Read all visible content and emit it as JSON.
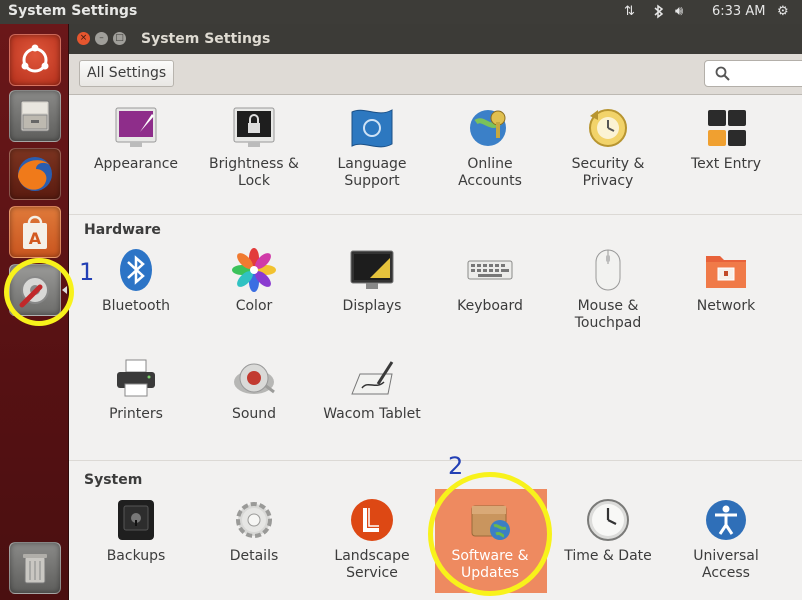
{
  "top_panel": {
    "title": "System Settings",
    "time": "6:33 AM",
    "icons": [
      "network-transfer-icon",
      "bluetooth-icon",
      "volume-icon",
      "power-gear-icon"
    ]
  },
  "launcher": {
    "items": [
      "ubuntu-dash-icon",
      "files-icon",
      "firefox-icon",
      "software-center-icon",
      "system-settings-icon",
      "trash-icon"
    ]
  },
  "window": {
    "title": "System Settings",
    "all_settings_label": "All Settings",
    "search_placeholder": ""
  },
  "personal": {
    "items": [
      {
        "label": "Appearance",
        "icon": "appearance-icon"
      },
      {
        "label": "Brightness &\nLock",
        "icon": "brightness-lock-icon"
      },
      {
        "label": "Language\nSupport",
        "icon": "language-support-icon"
      },
      {
        "label": "Online\nAccounts",
        "icon": "online-accounts-icon"
      },
      {
        "label": "Security &\nPrivacy",
        "icon": "security-privacy-icon"
      },
      {
        "label": "Text Entry",
        "icon": "text-entry-icon"
      }
    ]
  },
  "hardware": {
    "heading": "Hardware",
    "items": [
      {
        "label": "Bluetooth",
        "icon": "bluetooth-icon"
      },
      {
        "label": "Color",
        "icon": "color-icon"
      },
      {
        "label": "Displays",
        "icon": "displays-icon"
      },
      {
        "label": "Keyboard",
        "icon": "keyboard-icon"
      },
      {
        "label": "Mouse &\nTouchpad",
        "icon": "mouse-icon"
      },
      {
        "label": "Network",
        "icon": "network-icon"
      },
      {
        "label": "Printers",
        "icon": "printer-icon"
      },
      {
        "label": "Sound",
        "icon": "sound-icon"
      },
      {
        "label": "Wacom Tablet",
        "icon": "wacom-tablet-icon"
      }
    ]
  },
  "system": {
    "heading": "System",
    "items": [
      {
        "label": "Backups",
        "icon": "backups-icon"
      },
      {
        "label": "Details",
        "icon": "details-icon"
      },
      {
        "label": "Landscape\nService",
        "icon": "landscape-icon"
      },
      {
        "label": "Software &\nUpdates",
        "icon": "software-updates-icon"
      },
      {
        "label": "Time & Date",
        "icon": "clock-icon"
      },
      {
        "label": "Universal\nAccess",
        "icon": "universal-access-icon"
      }
    ]
  },
  "annotations": {
    "step1": "1",
    "step2": "2",
    "ring_color": "#f8f21b",
    "number_color": "#2340b5"
  },
  "colors": {
    "launcher": "#5a1214",
    "selected_tile": "#ee8a60",
    "window_bg": "#f2f1f0"
  }
}
